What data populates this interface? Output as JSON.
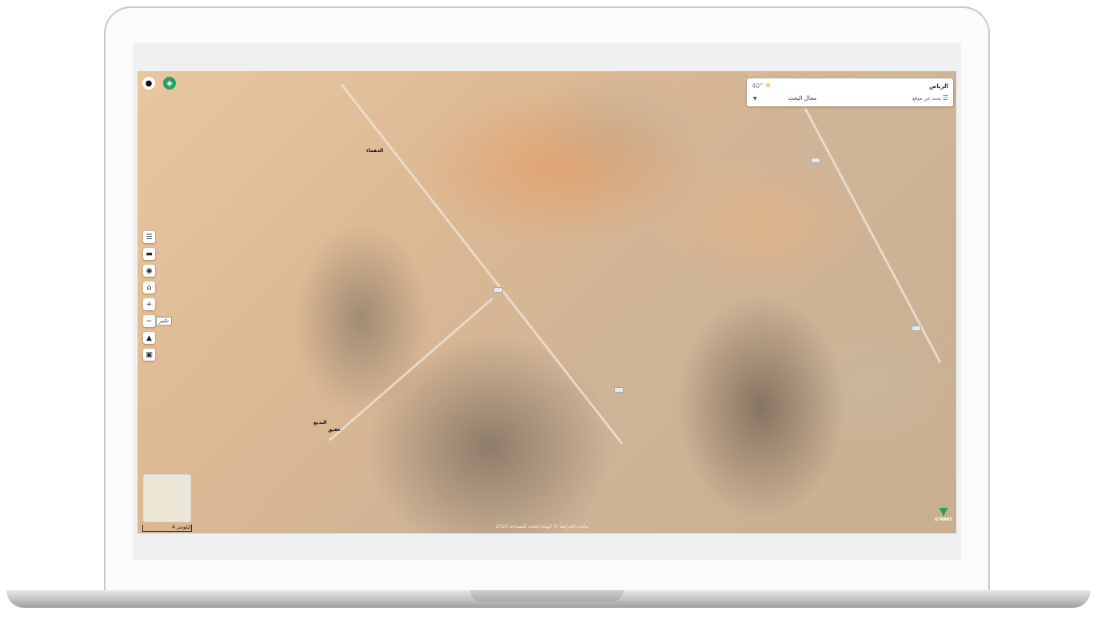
{
  "weather": {
    "city": "الرياض",
    "temperature": "40°",
    "icon": "sun-icon"
  },
  "search": {
    "placeholder": "بحث عن موقع",
    "area_label": "مجال البحث",
    "menu_icon": "menu-icon"
  },
  "toolbar": {
    "zoom_in": "+",
    "zoom_out": "−",
    "zoom_tooltip": "تكبير"
  },
  "map": {
    "scale_label": "4 كيلومتر",
    "attribution": "بيانات الخرائط © الهيئة العامة للمساحة 2020",
    "places": [
      "الدهماء",
      "البديع",
      "عقيق"
    ]
  },
  "brand": {
    "logo_text": "U MAPS",
    "accent_color": "#2b9c63"
  }
}
